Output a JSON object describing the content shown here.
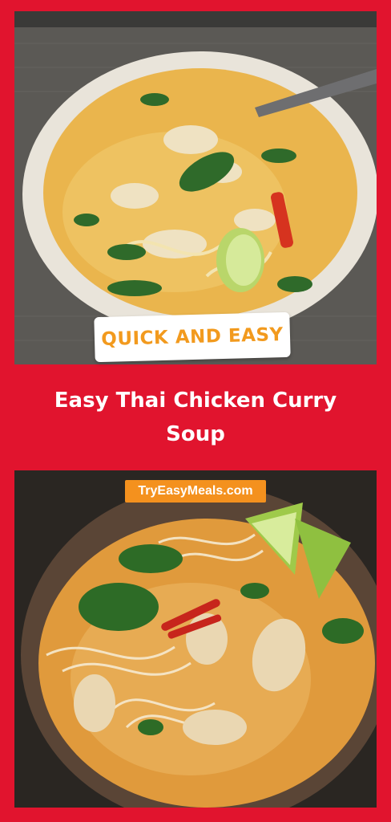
{
  "badge": {
    "text": "QUICK AND EASY"
  },
  "title": {
    "line1": "Easy Thai Chicken Curry",
    "line2": "Soup"
  },
  "site": {
    "label": "TryEasyMeals.com"
  },
  "colors": {
    "background": "#e1142e",
    "badge_text": "#f29a1e",
    "site_tag": "#f4911e"
  }
}
